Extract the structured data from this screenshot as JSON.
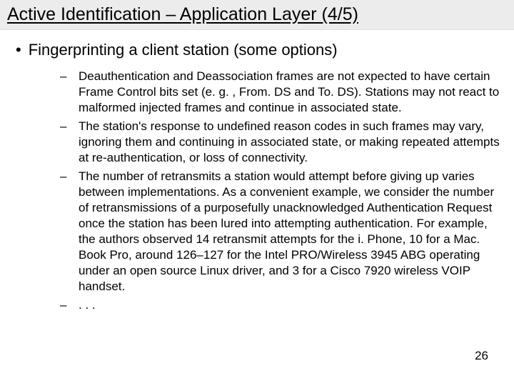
{
  "title": "Active Identification – Application Layer (4/5)",
  "main_bullet": "Fingerprinting a client station (some options)",
  "sub_bullets": [
    "Deauthentication and Deassociation frames are not expected to have certain Frame Control bits set (e. g. , From. DS and To. DS). Stations may not react to malformed injected frames and continue in associated state.",
    "The station's response to undefined reason codes in such frames may vary, ignoring them and continuing in associated state, or making repeated attempts at re-authentication, or loss of connectivity.",
    "The number of retransmits a station would attempt before giving up varies between implementations. As a convenient example, we consider the number of retransmissions of a purposefully unacknowledged Authentication Request once the station has been lured into attempting authentication. For example, the authors observed 14 retransmit attempts for the i. Phone, 10 for a Mac. Book Pro, around 126–127 for the Intel PRO/Wireless 3945 ABG operating under an open source Linux driver, and 3 for a Cisco 7920 wireless VOIP handset.",
    ". . ."
  ],
  "page_number": "26"
}
